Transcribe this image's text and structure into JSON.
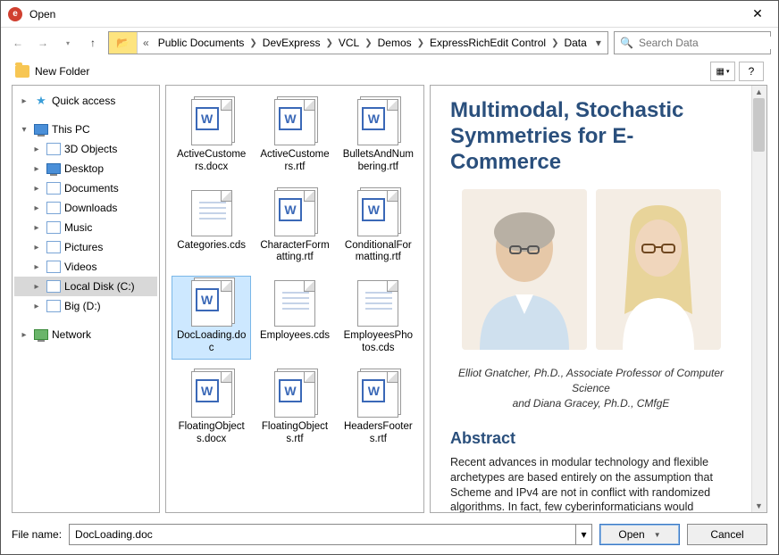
{
  "window": {
    "title": "Open"
  },
  "nav": {
    "breadcrumb": [
      "Public Documents",
      "DevExpress",
      "VCL",
      "Demos",
      "ExpressRichEdit Control",
      "Data"
    ],
    "search_placeholder": "Search Data"
  },
  "toolbar": {
    "new_folder": "New Folder"
  },
  "tree": {
    "quick_access": "Quick access",
    "this_pc": "This PC",
    "items": [
      "3D Objects",
      "Desktop",
      "Documents",
      "Downloads",
      "Music",
      "Pictures",
      "Videos",
      "Local Disk (C:)",
      "Big (D:)"
    ],
    "network": "Network"
  },
  "files": [
    {
      "name": "ActiveCustomers.docx",
      "type": "word"
    },
    {
      "name": "ActiveCustomers.rtf",
      "type": "word"
    },
    {
      "name": "BulletsAndNumbering.rtf",
      "type": "word"
    },
    {
      "name": "Categories.cds",
      "type": "plain"
    },
    {
      "name": "CharacterFormatting.rtf",
      "type": "word"
    },
    {
      "name": "ConditionalFormatting.rtf",
      "type": "word"
    },
    {
      "name": "DocLoading.doc",
      "type": "word",
      "selected": true
    },
    {
      "name": "Employees.cds",
      "type": "plain"
    },
    {
      "name": "EmployeesPhotos.cds",
      "type": "plain"
    },
    {
      "name": "FloatingObjects.docx",
      "type": "word"
    },
    {
      "name": "FloatingObjects.rtf",
      "type": "word"
    },
    {
      "name": "HeadersFooters.rtf",
      "type": "word"
    }
  ],
  "preview": {
    "title": "Multimodal, Stochastic Symmetries for E-Commerce",
    "byline1": "Elliot Gnatcher,  Ph.D.,  Associate Professor of Computer Science",
    "byline2": "and Diana Gracey, Ph.D., CMfgE",
    "abstract_heading": "Abstract",
    "abstract_body": "Recent advances in modular technology and flexible archetypes are based entirely on the assumption that Scheme and IPv4 are not in conflict with randomized algorithms. In fact, few cyberinformaticians would disagree with the study of"
  },
  "footer": {
    "label": "File name:",
    "value": "DocLoading.doc",
    "open": "Open",
    "cancel": "Cancel"
  }
}
